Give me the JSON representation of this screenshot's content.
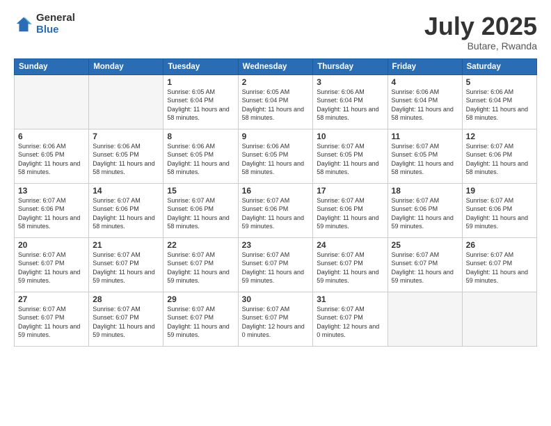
{
  "header": {
    "logo_general": "General",
    "logo_blue": "Blue",
    "month_title": "July 2025",
    "location": "Butare, Rwanda"
  },
  "weekdays": [
    "Sunday",
    "Monday",
    "Tuesday",
    "Wednesday",
    "Thursday",
    "Friday",
    "Saturday"
  ],
  "weeks": [
    [
      {
        "day": "",
        "info": ""
      },
      {
        "day": "",
        "info": ""
      },
      {
        "day": "1",
        "info": "Sunrise: 6:05 AM\nSunset: 6:04 PM\nDaylight: 11 hours and 58 minutes."
      },
      {
        "day": "2",
        "info": "Sunrise: 6:05 AM\nSunset: 6:04 PM\nDaylight: 11 hours and 58 minutes."
      },
      {
        "day": "3",
        "info": "Sunrise: 6:06 AM\nSunset: 6:04 PM\nDaylight: 11 hours and 58 minutes."
      },
      {
        "day": "4",
        "info": "Sunrise: 6:06 AM\nSunset: 6:04 PM\nDaylight: 11 hours and 58 minutes."
      },
      {
        "day": "5",
        "info": "Sunrise: 6:06 AM\nSunset: 6:04 PM\nDaylight: 11 hours and 58 minutes."
      }
    ],
    [
      {
        "day": "6",
        "info": "Sunrise: 6:06 AM\nSunset: 6:05 PM\nDaylight: 11 hours and 58 minutes."
      },
      {
        "day": "7",
        "info": "Sunrise: 6:06 AM\nSunset: 6:05 PM\nDaylight: 11 hours and 58 minutes."
      },
      {
        "day": "8",
        "info": "Sunrise: 6:06 AM\nSunset: 6:05 PM\nDaylight: 11 hours and 58 minutes."
      },
      {
        "day": "9",
        "info": "Sunrise: 6:06 AM\nSunset: 6:05 PM\nDaylight: 11 hours and 58 minutes."
      },
      {
        "day": "10",
        "info": "Sunrise: 6:07 AM\nSunset: 6:05 PM\nDaylight: 11 hours and 58 minutes."
      },
      {
        "day": "11",
        "info": "Sunrise: 6:07 AM\nSunset: 6:05 PM\nDaylight: 11 hours and 58 minutes."
      },
      {
        "day": "12",
        "info": "Sunrise: 6:07 AM\nSunset: 6:06 PM\nDaylight: 11 hours and 58 minutes."
      }
    ],
    [
      {
        "day": "13",
        "info": "Sunrise: 6:07 AM\nSunset: 6:06 PM\nDaylight: 11 hours and 58 minutes."
      },
      {
        "day": "14",
        "info": "Sunrise: 6:07 AM\nSunset: 6:06 PM\nDaylight: 11 hours and 58 minutes."
      },
      {
        "day": "15",
        "info": "Sunrise: 6:07 AM\nSunset: 6:06 PM\nDaylight: 11 hours and 58 minutes."
      },
      {
        "day": "16",
        "info": "Sunrise: 6:07 AM\nSunset: 6:06 PM\nDaylight: 11 hours and 59 minutes."
      },
      {
        "day": "17",
        "info": "Sunrise: 6:07 AM\nSunset: 6:06 PM\nDaylight: 11 hours and 59 minutes."
      },
      {
        "day": "18",
        "info": "Sunrise: 6:07 AM\nSunset: 6:06 PM\nDaylight: 11 hours and 59 minutes."
      },
      {
        "day": "19",
        "info": "Sunrise: 6:07 AM\nSunset: 6:06 PM\nDaylight: 11 hours and 59 minutes."
      }
    ],
    [
      {
        "day": "20",
        "info": "Sunrise: 6:07 AM\nSunset: 6:07 PM\nDaylight: 11 hours and 59 minutes."
      },
      {
        "day": "21",
        "info": "Sunrise: 6:07 AM\nSunset: 6:07 PM\nDaylight: 11 hours and 59 minutes."
      },
      {
        "day": "22",
        "info": "Sunrise: 6:07 AM\nSunset: 6:07 PM\nDaylight: 11 hours and 59 minutes."
      },
      {
        "day": "23",
        "info": "Sunrise: 6:07 AM\nSunset: 6:07 PM\nDaylight: 11 hours and 59 minutes."
      },
      {
        "day": "24",
        "info": "Sunrise: 6:07 AM\nSunset: 6:07 PM\nDaylight: 11 hours and 59 minutes."
      },
      {
        "day": "25",
        "info": "Sunrise: 6:07 AM\nSunset: 6:07 PM\nDaylight: 11 hours and 59 minutes."
      },
      {
        "day": "26",
        "info": "Sunrise: 6:07 AM\nSunset: 6:07 PM\nDaylight: 11 hours and 59 minutes."
      }
    ],
    [
      {
        "day": "27",
        "info": "Sunrise: 6:07 AM\nSunset: 6:07 PM\nDaylight: 11 hours and 59 minutes."
      },
      {
        "day": "28",
        "info": "Sunrise: 6:07 AM\nSunset: 6:07 PM\nDaylight: 11 hours and 59 minutes."
      },
      {
        "day": "29",
        "info": "Sunrise: 6:07 AM\nSunset: 6:07 PM\nDaylight: 11 hours and 59 minutes."
      },
      {
        "day": "30",
        "info": "Sunrise: 6:07 AM\nSunset: 6:07 PM\nDaylight: 12 hours and 0 minutes."
      },
      {
        "day": "31",
        "info": "Sunrise: 6:07 AM\nSunset: 6:07 PM\nDaylight: 12 hours and 0 minutes."
      },
      {
        "day": "",
        "info": ""
      },
      {
        "day": "",
        "info": ""
      }
    ]
  ]
}
